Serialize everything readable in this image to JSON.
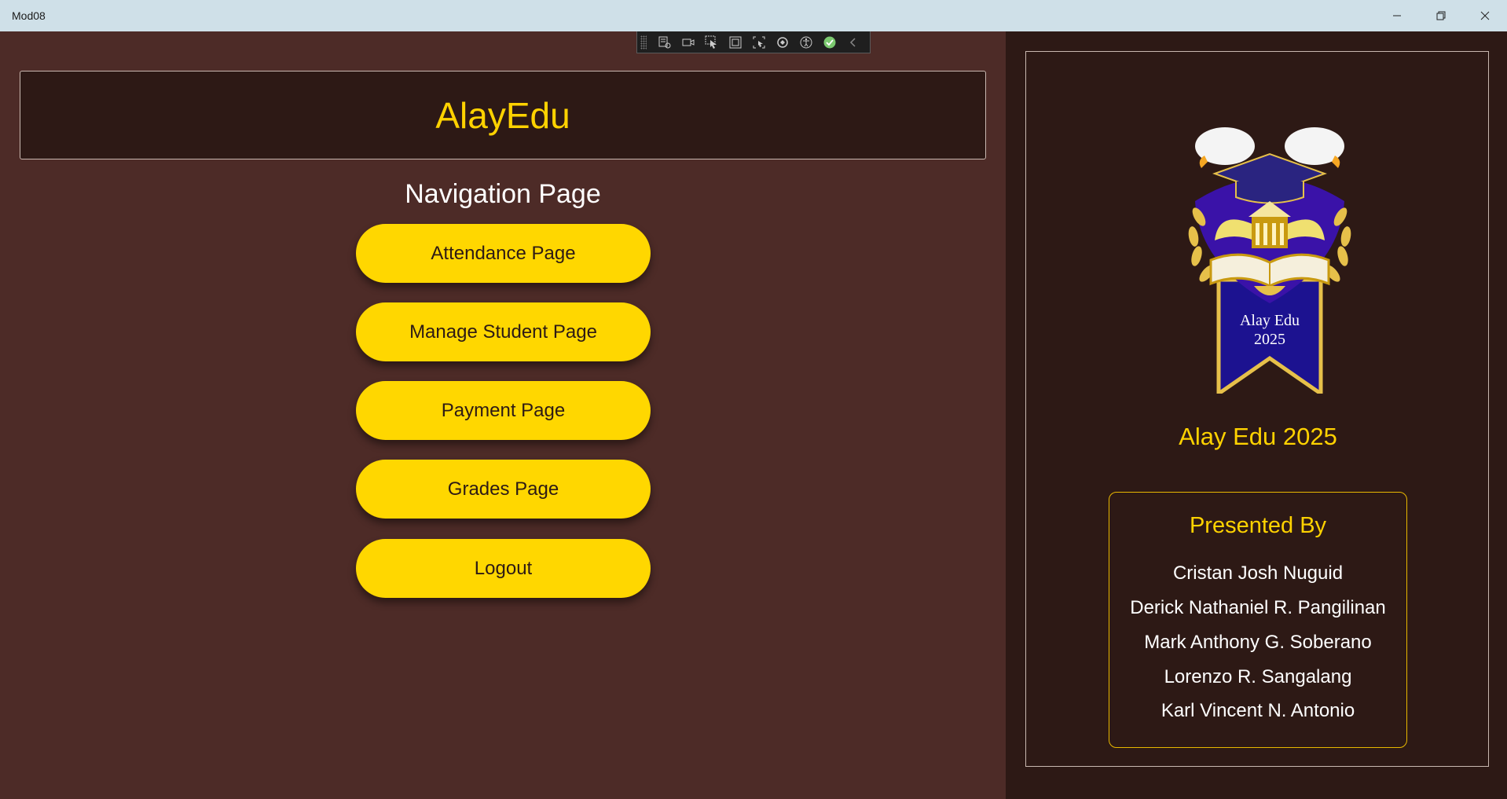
{
  "window": {
    "title": "Mod08",
    "minimize_icon": "minimize-icon",
    "maximize_icon": "restore-icon",
    "close_icon": "close-icon"
  },
  "debug_toolbar": {
    "icons": [
      "live-visual-tree-icon",
      "record-icon",
      "select-element-icon",
      "display-layout-adorners-icon",
      "track-focus-icon",
      "hot-reload-icon",
      "accessibility-icon",
      "binding-check-icon",
      "collapse-chevron-icon"
    ]
  },
  "header": {
    "app_name": "AlayEdu"
  },
  "navigation": {
    "title": "Navigation Page",
    "buttons": [
      {
        "label": "Attendance Page"
      },
      {
        "label": "Manage Student Page"
      },
      {
        "label": "Payment Page"
      },
      {
        "label": "Grades Page"
      },
      {
        "label": "Logout"
      }
    ]
  },
  "side_panel": {
    "logo_text_line1": "Alay Edu",
    "logo_text_line2": "2025",
    "caption": "Alay Edu 2025",
    "presented_by": {
      "title": "Presented By",
      "names": [
        "Cristan Josh Nuguid",
        "Derick Nathaniel R. Pangilinan",
        "Mark Anthony G. Soberano",
        "Lorenzo R. Sangalang",
        "Karl Vincent N. Antonio"
      ]
    }
  },
  "colors": {
    "accent": "#ffd700",
    "background": "#4d2b27",
    "panel": "#2d1915",
    "titlebar": "#cfe0e8"
  }
}
